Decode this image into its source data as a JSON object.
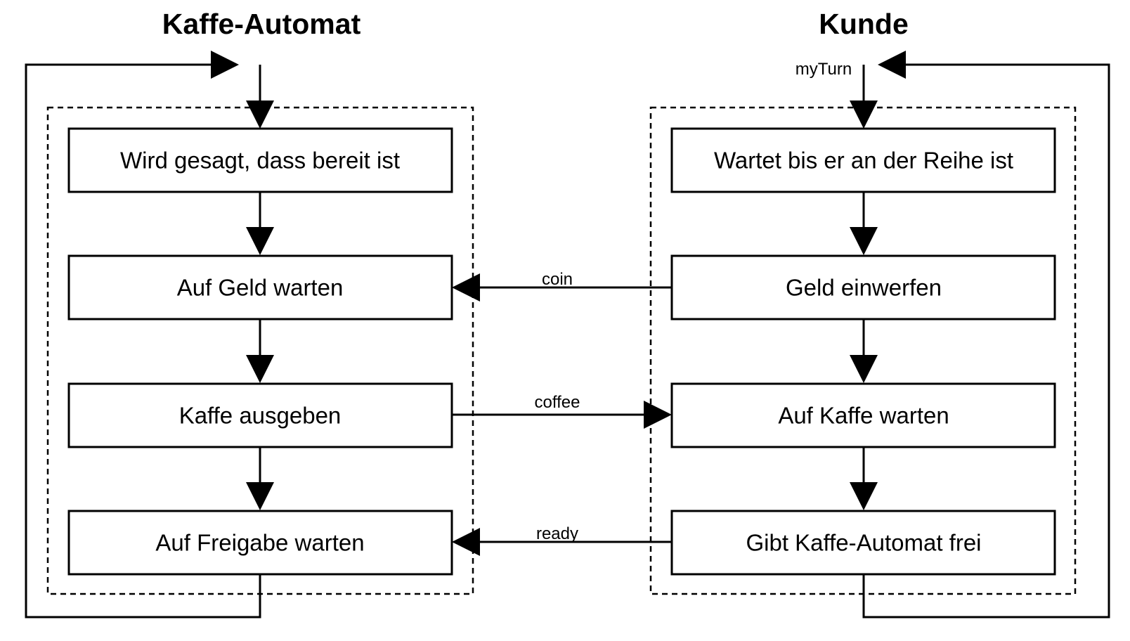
{
  "titles": {
    "machine": "Kaffe-Automat",
    "customer": "Kunde"
  },
  "machine_states": [
    "Wird gesagt, dass bereit ist",
    "Auf Geld warten",
    "Kaffe ausgeben",
    "Auf Freigabe warten"
  ],
  "customer_states": [
    "Wartet bis er an der Reihe ist",
    "Geld einwerfen",
    "Auf Kaffe warten",
    "Gibt Kaffe-Automat frei"
  ],
  "messages": {
    "coin": "coin",
    "coffee": "coffee",
    "ready": "ready",
    "my_turn": "myTurn"
  }
}
